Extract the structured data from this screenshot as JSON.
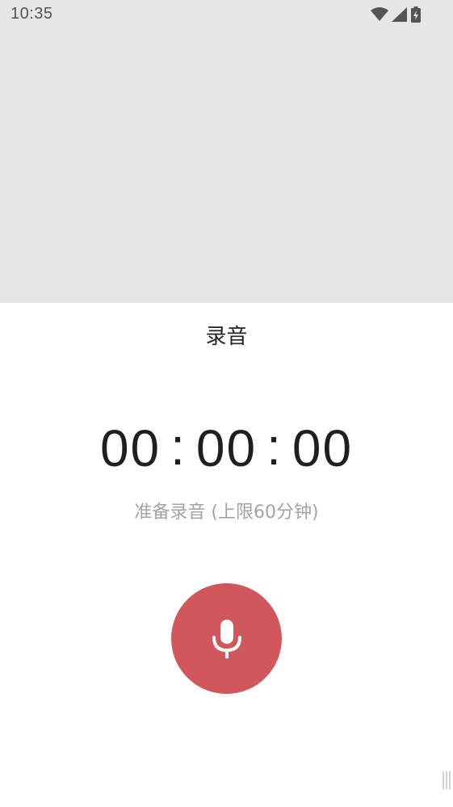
{
  "status_bar": {
    "time": "10:35",
    "icons": [
      "wifi-icon",
      "signal-icon",
      "battery-charging-icon"
    ]
  },
  "recorder": {
    "title": "录音",
    "timer": {
      "hours": "00",
      "minutes": "00",
      "seconds": "00",
      "separator": ":"
    },
    "hint": "准备录音 (上限60分钟)",
    "record_button_icon": "microphone-icon"
  },
  "colors": {
    "record_button": "#d0585c",
    "status_bar_bg": "#e6e6e6",
    "hint_text": "#a3a3a3"
  }
}
